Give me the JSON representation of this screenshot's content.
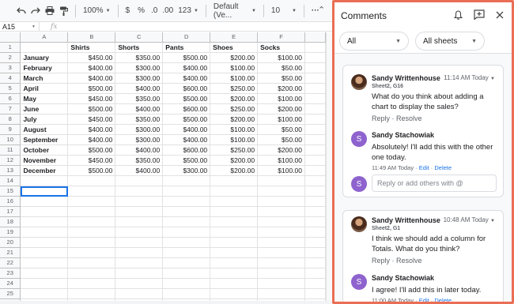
{
  "toolbar": {
    "zoom": "100%",
    "currency": "$",
    "percent": "%",
    "dec_decrease": ".0",
    "dec_increase": ".00",
    "number_format": "123",
    "font": "Default (Ve...",
    "font_size": "10",
    "more": "···"
  },
  "formula_bar": {
    "cell_ref": "A15",
    "fx": "fx",
    "value": ""
  },
  "grid": {
    "columns": [
      "A",
      "B",
      "C",
      "D",
      "E",
      "F"
    ],
    "header_row": [
      "",
      "Shirts",
      "Shorts",
      "Pants",
      "Shoes",
      "Socks"
    ],
    "rows": [
      [
        "January",
        "$450.00",
        "$350.00",
        "$500.00",
        "$200.00",
        "$100.00"
      ],
      [
        "February",
        "$400.00",
        "$300.00",
        "$400.00",
        "$100.00",
        "$50.00"
      ],
      [
        "March",
        "$400.00",
        "$300.00",
        "$400.00",
        "$100.00",
        "$50.00"
      ],
      [
        "April",
        "$500.00",
        "$400.00",
        "$600.00",
        "$250.00",
        "$200.00"
      ],
      [
        "May",
        "$450.00",
        "$350.00",
        "$500.00",
        "$200.00",
        "$100.00"
      ],
      [
        "June",
        "$500.00",
        "$400.00",
        "$600.00",
        "$250.00",
        "$200.00"
      ],
      [
        "July",
        "$450.00",
        "$350.00",
        "$500.00",
        "$200.00",
        "$100.00"
      ],
      [
        "August",
        "$400.00",
        "$300.00",
        "$400.00",
        "$100.00",
        "$50.00"
      ],
      [
        "September",
        "$400.00",
        "$300.00",
        "$400.00",
        "$100.00",
        "$50.00"
      ],
      [
        "October",
        "$500.00",
        "$400.00",
        "$600.00",
        "$250.00",
        "$200.00"
      ],
      [
        "November",
        "$450.00",
        "$350.00",
        "$500.00",
        "$200.00",
        "$100.00"
      ],
      [
        "December",
        "$500.00",
        "$400.00",
        "$300.00",
        "$200.00",
        "$100.00"
      ]
    ],
    "row_numbers": [
      "1",
      "2",
      "3",
      "4",
      "5",
      "6",
      "7",
      "8",
      "9",
      "10",
      "11",
      "12",
      "13",
      "14",
      "15",
      "16",
      "17",
      "18",
      "19",
      "20",
      "21",
      "22",
      "23",
      "24",
      "25",
      "26"
    ],
    "selected_cell": "A15"
  },
  "comments_panel": {
    "title": "Comments",
    "filter_scope": "All",
    "filter_sheets": "All sheets",
    "threads": [
      {
        "author": "Sandy Writtenhouse",
        "time": "11:14 AM Today",
        "location": "Sheet2, G16",
        "body": "What do you think about adding a chart to display the sales?",
        "actions": [
          "Reply",
          "Resolve"
        ],
        "reply": {
          "author": "Sandy Stachowiak",
          "initial": "S",
          "body": "Absolutely! I'll add this with the other one today.",
          "time": "11:49 AM Today",
          "links": [
            "Edit",
            "Delete"
          ]
        },
        "reply_placeholder": "Reply or add others with @"
      },
      {
        "author": "Sandy Writtenhouse",
        "time": "10:48 AM Today",
        "location": "Sheet2, G1",
        "body": "I think we should add a column for Totals. What do you think?",
        "actions": [
          "Reply",
          "Resolve"
        ],
        "reply": {
          "author": "Sandy Stachowiak",
          "initial": "S",
          "body": "I agree! I'll add this in later today.",
          "time": "11:00 AM Today",
          "links": [
            "Edit",
            "Delete"
          ]
        }
      }
    ],
    "colors": {
      "highlight_border": "#ea6e55",
      "link": "#1a73e8",
      "avatar_letter_bg": "#8e63ce"
    }
  }
}
